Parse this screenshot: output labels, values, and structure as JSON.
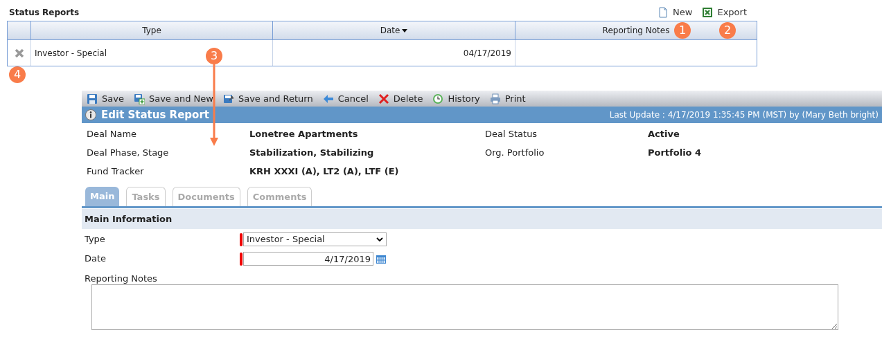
{
  "list": {
    "title": "Status Reports",
    "actions": [
      {
        "kind": "new",
        "label": "New"
      },
      {
        "kind": "export",
        "label": "Export"
      }
    ],
    "columns": [
      {
        "label": "Type",
        "sorted": false
      },
      {
        "label": "Date",
        "sorted": true
      },
      {
        "label": "Reporting Notes",
        "sorted": false
      }
    ],
    "rows": [
      {
        "cells": [
          "Investor - Special",
          "04/17/2019",
          ""
        ]
      }
    ]
  },
  "callouts": [
    {
      "label": "1",
      "kind": "dot"
    },
    {
      "label": "2",
      "kind": "dot"
    },
    {
      "label": "3",
      "kind": "arrow"
    },
    {
      "label": "4",
      "kind": "dot"
    }
  ],
  "form": {
    "toolbar": [
      {
        "kind": "save",
        "label": "Save"
      },
      {
        "kind": "save_new",
        "label": "Save and New"
      },
      {
        "kind": "save_return",
        "label": "Save and Return"
      },
      {
        "kind": "cancel",
        "label": "Cancel"
      },
      {
        "kind": "delete",
        "label": "Delete"
      },
      {
        "kind": "history",
        "label": "History"
      },
      {
        "kind": "print",
        "label": "Print"
      }
    ],
    "title": "Edit Status Report",
    "last_update": "Last Update : 4/17/2019 1:35:45 PM (MST) by (Mary Beth bright)",
    "info": [
      {
        "label": "Deal Name",
        "value": "Lonetree Apartments"
      },
      {
        "label": "Deal Status",
        "value": "Active"
      },
      {
        "label": "Deal Phase, Stage",
        "value": "Stabilization, Stabilizing"
      },
      {
        "label": "Org. Portfolio",
        "value": "Portfolio 4"
      },
      {
        "label": "Fund Tracker",
        "value": "KRH XXXI (A), LT2 (A), LTF (E)"
      }
    ],
    "tabs": [
      {
        "label": "Main",
        "selected": true
      },
      {
        "label": "Tasks",
        "selected": false
      },
      {
        "label": "Documents",
        "selected": false
      },
      {
        "label": "Comments",
        "selected": false
      }
    ],
    "section": "Main Information",
    "fields": [
      {
        "kind": "select",
        "label": "Type",
        "value": "Investor - Special",
        "required": true
      },
      {
        "kind": "date",
        "label": "Date",
        "value": "4/17/2019",
        "required": true
      },
      {
        "kind": "textarea",
        "label": "Reporting Notes",
        "required": false
      }
    ]
  }
}
